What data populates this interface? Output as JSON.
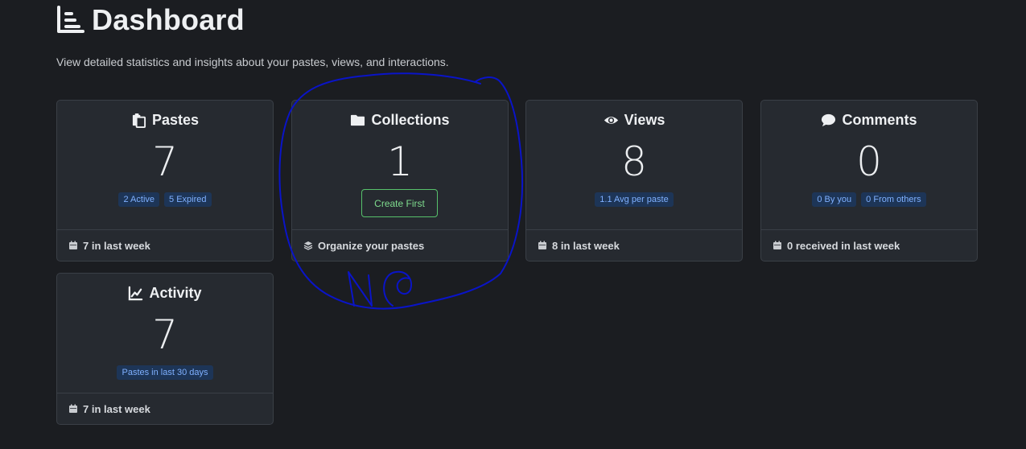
{
  "header": {
    "title": "Dashboard",
    "subtitle": "View detailed statistics and insights about your pastes, views, and interactions."
  },
  "cards": {
    "pastes": {
      "title": "Pastes",
      "icon": "copy-icon",
      "value": "7",
      "badges": [
        "2 Active",
        "5 Expired"
      ],
      "footer": "7 in last week",
      "footer_icon": "calendar-icon"
    },
    "collections": {
      "title": "Collections",
      "icon": "folder-icon",
      "value": "1",
      "button": "Create First",
      "footer": "Organize your pastes",
      "footer_icon": "layers-icon"
    },
    "views": {
      "title": "Views",
      "icon": "eye-icon",
      "value": "8",
      "badges": [
        "1.1 Avg per paste"
      ],
      "footer": "8 in last week",
      "footer_icon": "calendar-icon"
    },
    "comments": {
      "title": "Comments",
      "icon": "comment-icon",
      "value": "0",
      "badges": [
        "0 By you",
        "0 From others"
      ],
      "footer": "0 received in last week",
      "footer_icon": "calendar-icon"
    },
    "activity": {
      "title": "Activity",
      "icon": "line-chart-icon",
      "value": "7",
      "badges": [
        "Pastes in last 30 days"
      ],
      "footer": "7 in last week",
      "footer_icon": "calendar-icon"
    }
  },
  "annotation": {
    "text": "NO",
    "color": "#0a14c8"
  }
}
